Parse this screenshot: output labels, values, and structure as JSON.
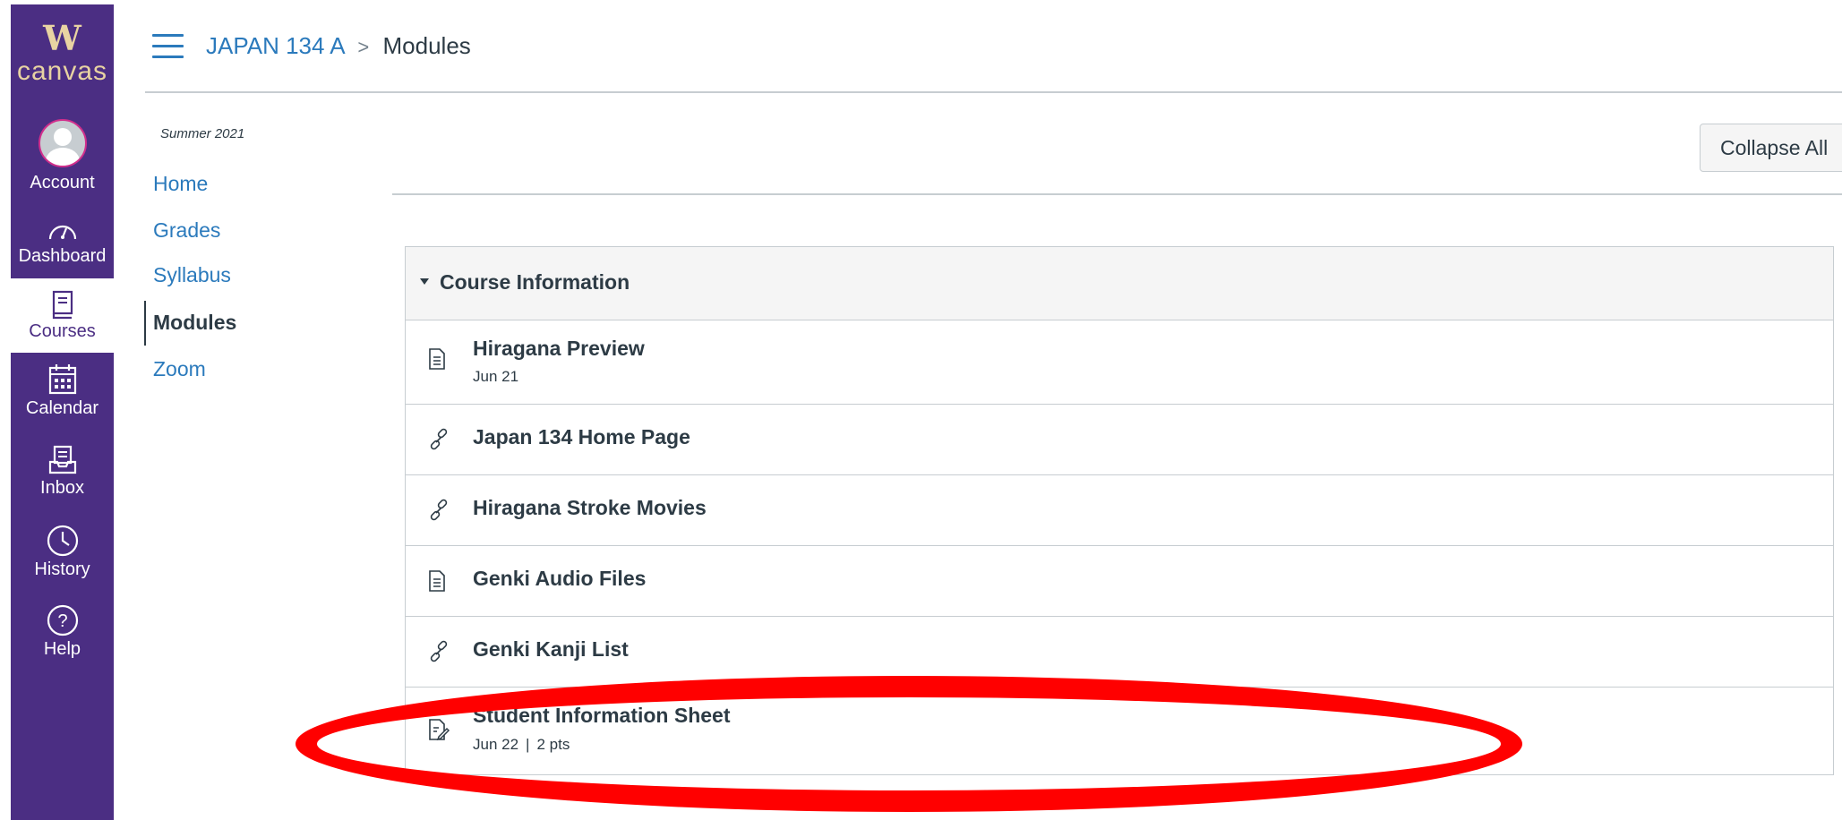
{
  "global_nav": {
    "logo_mark": "W",
    "logo_text": "canvas",
    "items": [
      {
        "label": "Account",
        "icon": "avatar-icon"
      },
      {
        "label": "Dashboard",
        "icon": "dashboard-gauge-icon"
      },
      {
        "label": "Courses",
        "icon": "courses-book-icon",
        "active": true
      },
      {
        "label": "Calendar",
        "icon": "calendar-icon"
      },
      {
        "label": "Inbox",
        "icon": "inbox-icon"
      },
      {
        "label": "History",
        "icon": "clock-icon"
      },
      {
        "label": "Help",
        "icon": "help-question-icon"
      }
    ]
  },
  "header": {
    "breadcrumb_course": "JAPAN 134 A",
    "breadcrumb_separator": ">",
    "breadcrumb_current": "Modules"
  },
  "course_nav": {
    "term": "Summer 2021",
    "items": [
      {
        "label": "Home"
      },
      {
        "label": "Grades"
      },
      {
        "label": "Syllabus"
      },
      {
        "label": "Modules",
        "active": true
      },
      {
        "label": "Zoom"
      }
    ]
  },
  "toolbar": {
    "collapse_all_label": "Collapse All"
  },
  "module": {
    "title": "Course Information",
    "items": [
      {
        "title": "Hiragana Preview",
        "meta_date": "Jun 21",
        "icon": "page-icon"
      },
      {
        "title": "Japan 134 Home Page",
        "icon": "link-icon"
      },
      {
        "title": "Hiragana Stroke Movies",
        "icon": "link-icon"
      },
      {
        "title": "Genki Audio Files",
        "icon": "page-icon"
      },
      {
        "title": "Genki Kanji List",
        "icon": "link-icon"
      },
      {
        "title": "Student Information Sheet",
        "meta_date": "Jun 22",
        "meta_sep": "|",
        "meta_points": "2 pts",
        "icon": "assignment-icon"
      }
    ]
  },
  "colors": {
    "nav_background": "#4b2e83",
    "logo_gold": "#e8d3a2",
    "link_blue": "#2b7abc",
    "annotation_red": "#ff0000"
  }
}
